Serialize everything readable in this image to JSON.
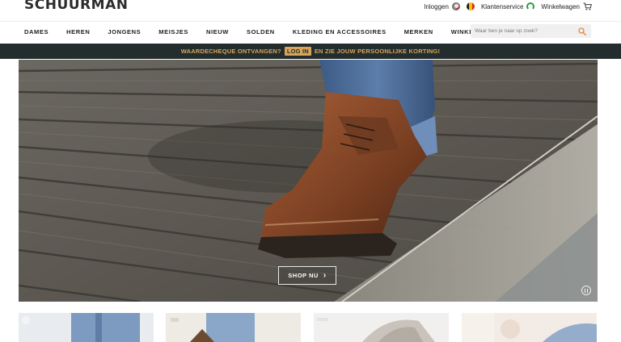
{
  "brand": {
    "logo_text": "SCHUURMAN"
  },
  "utility": {
    "login_label": "Inloggen",
    "service_label": "Klantenservice",
    "cart_label": "Winkelwagen",
    "icons": [
      "user-icon",
      "belgium-flag-icon",
      "headset-icon",
      "cart-icon"
    ],
    "flag_colors": [
      "#1a1a1a",
      "#f5c400",
      "#e0262b"
    ]
  },
  "nav": {
    "items": [
      "DAMES",
      "HEREN",
      "JONGENS",
      "MEISJES",
      "NIEUW",
      "SOLDEN",
      "KLEDING EN ACCESSOIRES",
      "MERKEN",
      "WINKELS"
    ]
  },
  "search": {
    "placeholder": "Waar ben je naar op zoek?",
    "icon": "search-icon",
    "icon_color": "#e2893c"
  },
  "promo": {
    "text_before": "WAARDECHEQUE ONTVANGEN?",
    "login_button": "LOG IN",
    "text_after": "EN ZIE JOUW PERSOONLIJKE KORTING!",
    "background": "#242d2d",
    "accent": "#d8a55b"
  },
  "hero": {
    "cta_label": "SHOP NU",
    "cta_icon": "chevron-right-icon",
    "pause_icon": "pause-icon"
  }
}
